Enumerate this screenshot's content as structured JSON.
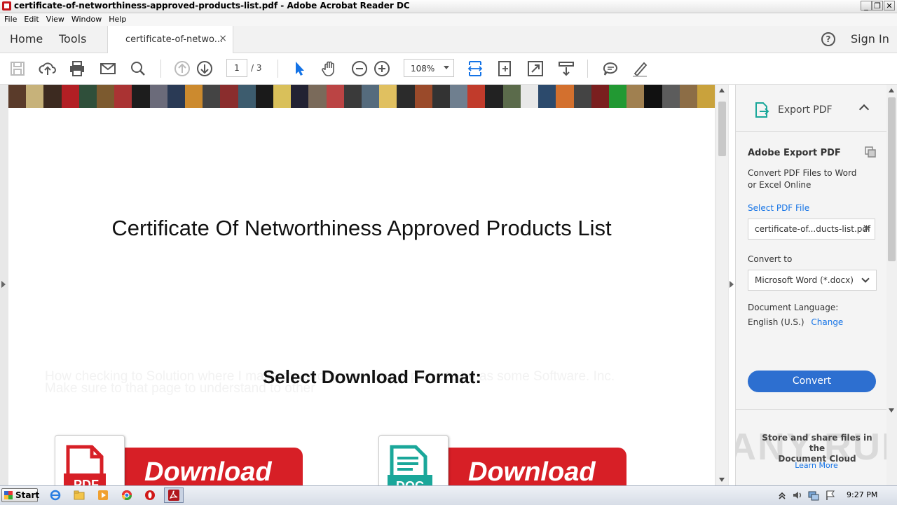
{
  "window": {
    "title": "certificate-of-networthiness-approved-products-list.pdf - Adobe Acrobat Reader DC",
    "controls": {
      "minimize": "_",
      "restore": "❐",
      "close": "✕"
    }
  },
  "menu": [
    "File",
    "Edit",
    "View",
    "Window",
    "Help"
  ],
  "tabs": {
    "home": "Home",
    "tools": "Tools",
    "document": "certificate-of-netwo...",
    "close": "×",
    "help": "?",
    "sign_in": "Sign In"
  },
  "toolbar": {
    "page_current": "1",
    "page_total": "/ 3",
    "zoom": "108%"
  },
  "document": {
    "title": "Certificate Of Networthiness Approved Products List",
    "ghost_line_1": "How checking to Solution where I make my shopping is find a place to be as some Software. Inc.",
    "ghost_line_2": "Make sure to that page to understand to other",
    "select_format": "Select Download Format:",
    "buttons": [
      {
        "label": "Download",
        "badge": "PDF"
      },
      {
        "label": "Download",
        "badge": "DOC"
      }
    ],
    "banner_colors": [
      "#5a3b2a",
      "#c7b27a",
      "#3c2a20",
      "#b21f24",
      "#2f4f3a",
      "#7c5a2f",
      "#a33",
      "#1d1d1d",
      "#6b6b7a",
      "#2a3a55",
      "#cc8a2e",
      "#444",
      "#8a2d2d",
      "#3d5c6e",
      "#1a1a1a",
      "#d9c05a",
      "#223",
      "#7a6a5a",
      "#b44",
      "#3a3a3a",
      "#556b7d",
      "#e0c060",
      "#2b2b2b",
      "#9a4a2a",
      "#333",
      "#6f7f8f",
      "#c13b2b",
      "#222",
      "#5b6b4b",
      "#e8e8e8",
      "#2c4a6c",
      "#d3702e",
      "#444",
      "#7a1f1f",
      "#293",
      "#a08050",
      "#111",
      "#5c5c5c",
      "#8c6d46",
      "#c9a23c"
    ]
  },
  "pane": {
    "header": "Export PDF",
    "section_title": "Adobe Export PDF",
    "description_1": "Convert PDF Files to Word",
    "description_2": "or Excel Online",
    "select_file": "Select PDF File",
    "file_name": "certificate-of...ducts-list.pdf",
    "file_clear": "✕",
    "convert_to": "Convert to",
    "convert_format": "Microsoft Word (*.docx)",
    "doc_lang_label": "Document Language:",
    "doc_lang": "English (U.S.)",
    "change": "Change",
    "convert_button": "Convert",
    "cloud_line_1": "Store and share files in the",
    "cloud_line_2": "Document Cloud",
    "learn_more": "Learn More",
    "watermark": "ANY RUN"
  },
  "taskbar": {
    "start": "Start",
    "clock": "9:27 PM"
  },
  "colors": {
    "accent": "#1473e6",
    "convert_button": "#2d6fd0",
    "download_red": "#d71f26",
    "pdf_icon": "#d71f26",
    "doc_icon": "#1aa79a"
  }
}
